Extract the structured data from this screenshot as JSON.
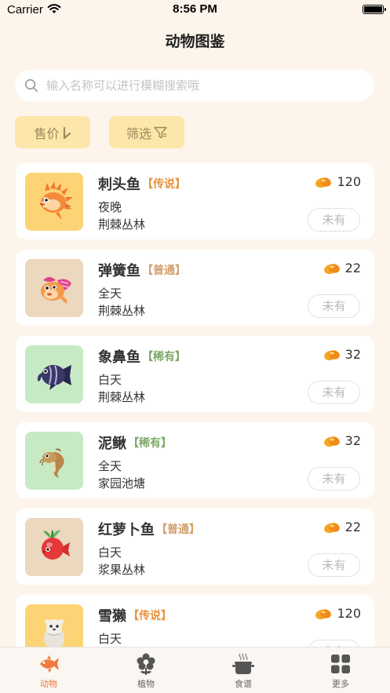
{
  "status_bar": {
    "carrier": "Carrier",
    "time": "8:56 PM"
  },
  "nav": {
    "title": "动物图鉴"
  },
  "search": {
    "placeholder": "输入名称可以进行模糊搜索哦",
    "value": ""
  },
  "filters": {
    "price_label": "售价",
    "filter_label": "筛选"
  },
  "colors": {
    "accent": "#f07b3f",
    "legendary": "#e8923a",
    "common": "#d2a06a",
    "rare": "#7fa86a",
    "button_bg": "#fce6a9"
  },
  "items": [
    {
      "name": "刺头鱼",
      "rarity": "【传说】",
      "rarity_type": "legendary",
      "time": "夜晚",
      "location": "荆棘丛林",
      "price": "120",
      "status": "未有"
    },
    {
      "name": "弹簧鱼",
      "rarity": "【普通】",
      "rarity_type": "common",
      "time": "全天",
      "location": "荆棘丛林",
      "price": "22",
      "status": "未有"
    },
    {
      "name": "象鼻鱼",
      "rarity": "【稀有】",
      "rarity_type": "rare",
      "time": "白天",
      "location": "荆棘丛林",
      "price": "32",
      "status": "未有"
    },
    {
      "name": "泥鳅",
      "rarity": "【稀有】",
      "rarity_type": "rare",
      "time": "全天",
      "location": "家园池塘",
      "price": "32",
      "status": "未有"
    },
    {
      "name": "红萝卜鱼",
      "rarity": "【普通】",
      "rarity_type": "common",
      "time": "白天",
      "location": "浆果丛林",
      "price": "22",
      "status": "未有"
    },
    {
      "name": "雪獭",
      "rarity": "【传说】",
      "rarity_type": "legendary",
      "time": "白天",
      "location": "",
      "price": "120",
      "status": "未有"
    }
  ],
  "tabs": [
    {
      "label": "动物",
      "icon": "fish-icon",
      "active": true
    },
    {
      "label": "植物",
      "icon": "flower-icon",
      "active": false
    },
    {
      "label": "食谱",
      "icon": "pot-icon",
      "active": false
    },
    {
      "label": "更多",
      "icon": "grid-icon",
      "active": false
    }
  ]
}
